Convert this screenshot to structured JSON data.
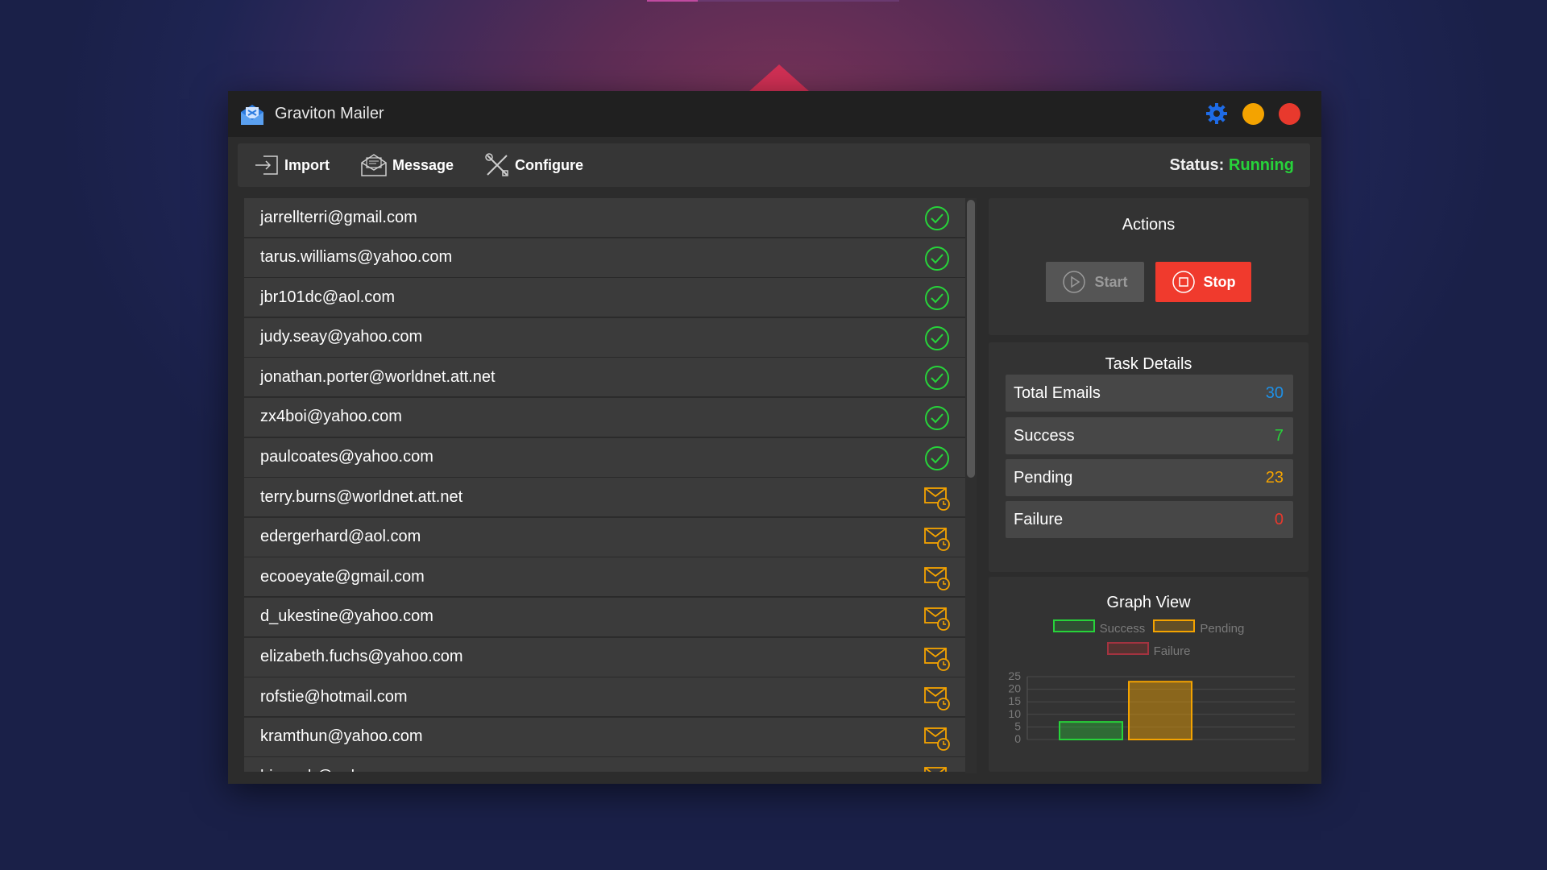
{
  "app": {
    "title": "Graviton Mailer"
  },
  "toolbar": {
    "import_label": "Import",
    "message_label": "Message",
    "configure_label": "Configure",
    "status_label": "Status:",
    "status_value": "Running"
  },
  "emails": [
    {
      "address": "jarrellterri@gmail.com",
      "state": "success"
    },
    {
      "address": "tarus.williams@yahoo.com",
      "state": "success"
    },
    {
      "address": "jbr101dc@aol.com",
      "state": "success"
    },
    {
      "address": "judy.seay@yahoo.com",
      "state": "success"
    },
    {
      "address": "jonathan.porter@worldnet.att.net",
      "state": "success"
    },
    {
      "address": "zx4boi@yahoo.com",
      "state": "success"
    },
    {
      "address": "paulcoates@yahoo.com",
      "state": "success"
    },
    {
      "address": "terry.burns@worldnet.att.net",
      "state": "pending"
    },
    {
      "address": "edergerhard@aol.com",
      "state": "pending"
    },
    {
      "address": "ecooeyate@gmail.com",
      "state": "pending"
    },
    {
      "address": "d_ukestine@yahoo.com",
      "state": "pending"
    },
    {
      "address": "elizabeth.fuchs@yahoo.com",
      "state": "pending"
    },
    {
      "address": "rofstie@hotmail.com",
      "state": "pending"
    },
    {
      "address": "kramthun@yahoo.com",
      "state": "pending"
    },
    {
      "address": "bjanach@aol.com",
      "state": "pending"
    }
  ],
  "actions": {
    "title": "Actions",
    "start_label": "Start",
    "stop_label": "Stop"
  },
  "tasks": {
    "title": "Task Details",
    "rows": [
      {
        "label": "Total Emails",
        "value": "30",
        "color": "#1e90e6"
      },
      {
        "label": "Success",
        "value": "7",
        "color": "#27d33a"
      },
      {
        "label": "Pending",
        "value": "23",
        "color": "#f4a300"
      },
      {
        "label": "Failure",
        "value": "0",
        "color": "#e8392d"
      }
    ]
  },
  "graph": {
    "title": "Graph View"
  },
  "chart_data": {
    "type": "bar",
    "categories": [
      "Success",
      "Pending",
      "Failure"
    ],
    "values": [
      7,
      23,
      0
    ],
    "colors": [
      "#27d33a",
      "#f4a300",
      "#e8392d"
    ],
    "legend": [
      "Success",
      "Pending",
      "Failure"
    ],
    "yticks": [
      "0",
      "5",
      "10",
      "15",
      "20",
      "25"
    ],
    "ylim": [
      0,
      25
    ],
    "grid": true,
    "legend_position": "top"
  },
  "colors": {
    "success": "#27d33a",
    "pending": "#f4a300",
    "failure": "#e8392d",
    "total": "#1e90e6",
    "accent": "#1e6be6"
  }
}
